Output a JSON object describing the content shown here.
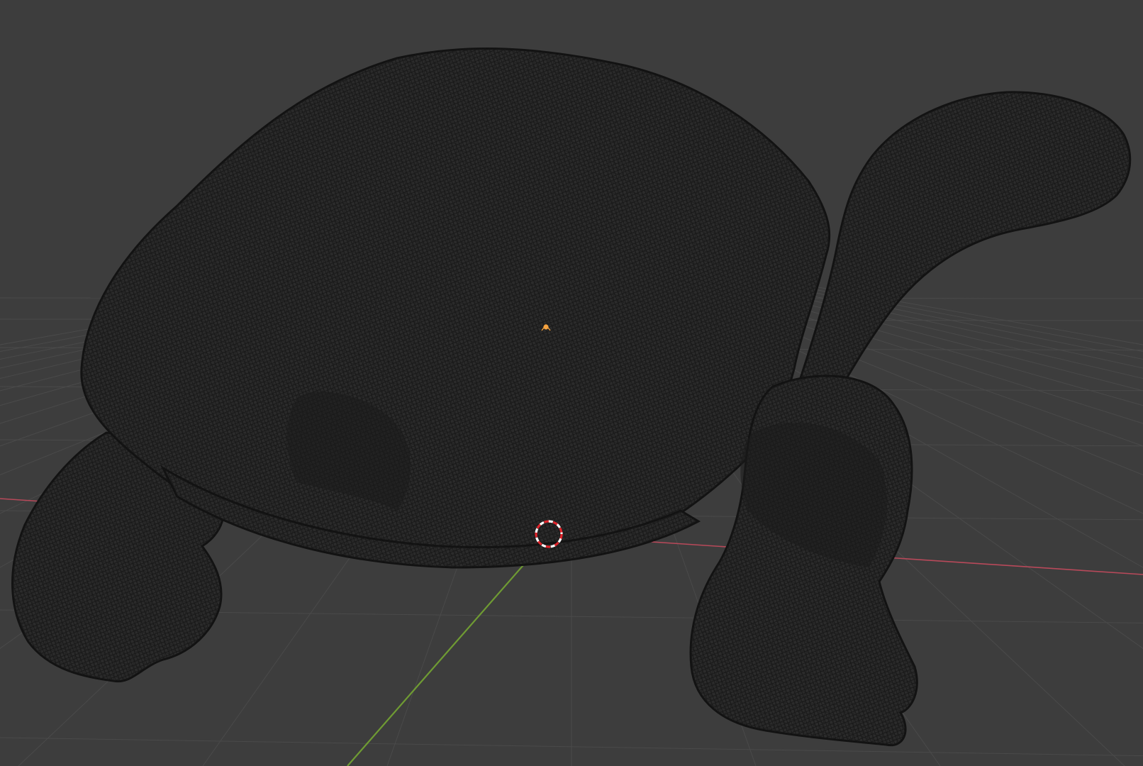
{
  "app": {
    "view": "3D Viewport",
    "shading_mode": "wireframe"
  },
  "scene": {
    "object": {
      "type": "mesh",
      "subject": "tortoise",
      "display": "wireframe",
      "selected": false
    },
    "icons": {
      "cursor": "3d-cursor-icon",
      "origin": "object-origin-icon"
    }
  },
  "colors": {
    "background": "#3d3d3d",
    "grid_line": "#4a4a4a",
    "x_axis": "#b8495a",
    "y_axis": "#6f9b33",
    "wire": "#121212",
    "mesh_fill": "#2b2b2b",
    "origin": "#f4a340",
    "cursor_red": "#e0242b",
    "cursor_white": "#ffffff"
  }
}
